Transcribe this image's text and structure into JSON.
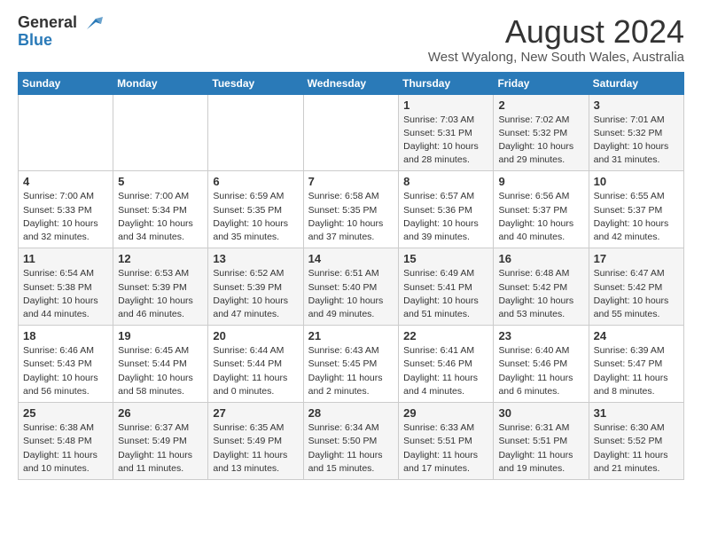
{
  "header": {
    "logo_line1": "General",
    "logo_line2": "Blue",
    "title": "August 2024",
    "subtitle": "West Wyalong, New South Wales, Australia"
  },
  "weekdays": [
    "Sunday",
    "Monday",
    "Tuesday",
    "Wednesday",
    "Thursday",
    "Friday",
    "Saturday"
  ],
  "weeks": [
    [
      {
        "day": "",
        "info": ""
      },
      {
        "day": "",
        "info": ""
      },
      {
        "day": "",
        "info": ""
      },
      {
        "day": "",
        "info": ""
      },
      {
        "day": "1",
        "info": "Sunrise: 7:03 AM\nSunset: 5:31 PM\nDaylight: 10 hours\nand 28 minutes."
      },
      {
        "day": "2",
        "info": "Sunrise: 7:02 AM\nSunset: 5:32 PM\nDaylight: 10 hours\nand 29 minutes."
      },
      {
        "day": "3",
        "info": "Sunrise: 7:01 AM\nSunset: 5:32 PM\nDaylight: 10 hours\nand 31 minutes."
      }
    ],
    [
      {
        "day": "4",
        "info": "Sunrise: 7:00 AM\nSunset: 5:33 PM\nDaylight: 10 hours\nand 32 minutes."
      },
      {
        "day": "5",
        "info": "Sunrise: 7:00 AM\nSunset: 5:34 PM\nDaylight: 10 hours\nand 34 minutes."
      },
      {
        "day": "6",
        "info": "Sunrise: 6:59 AM\nSunset: 5:35 PM\nDaylight: 10 hours\nand 35 minutes."
      },
      {
        "day": "7",
        "info": "Sunrise: 6:58 AM\nSunset: 5:35 PM\nDaylight: 10 hours\nand 37 minutes."
      },
      {
        "day": "8",
        "info": "Sunrise: 6:57 AM\nSunset: 5:36 PM\nDaylight: 10 hours\nand 39 minutes."
      },
      {
        "day": "9",
        "info": "Sunrise: 6:56 AM\nSunset: 5:37 PM\nDaylight: 10 hours\nand 40 minutes."
      },
      {
        "day": "10",
        "info": "Sunrise: 6:55 AM\nSunset: 5:37 PM\nDaylight: 10 hours\nand 42 minutes."
      }
    ],
    [
      {
        "day": "11",
        "info": "Sunrise: 6:54 AM\nSunset: 5:38 PM\nDaylight: 10 hours\nand 44 minutes."
      },
      {
        "day": "12",
        "info": "Sunrise: 6:53 AM\nSunset: 5:39 PM\nDaylight: 10 hours\nand 46 minutes."
      },
      {
        "day": "13",
        "info": "Sunrise: 6:52 AM\nSunset: 5:39 PM\nDaylight: 10 hours\nand 47 minutes."
      },
      {
        "day": "14",
        "info": "Sunrise: 6:51 AM\nSunset: 5:40 PM\nDaylight: 10 hours\nand 49 minutes."
      },
      {
        "day": "15",
        "info": "Sunrise: 6:49 AM\nSunset: 5:41 PM\nDaylight: 10 hours\nand 51 minutes."
      },
      {
        "day": "16",
        "info": "Sunrise: 6:48 AM\nSunset: 5:42 PM\nDaylight: 10 hours\nand 53 minutes."
      },
      {
        "day": "17",
        "info": "Sunrise: 6:47 AM\nSunset: 5:42 PM\nDaylight: 10 hours\nand 55 minutes."
      }
    ],
    [
      {
        "day": "18",
        "info": "Sunrise: 6:46 AM\nSunset: 5:43 PM\nDaylight: 10 hours\nand 56 minutes."
      },
      {
        "day": "19",
        "info": "Sunrise: 6:45 AM\nSunset: 5:44 PM\nDaylight: 10 hours\nand 58 minutes."
      },
      {
        "day": "20",
        "info": "Sunrise: 6:44 AM\nSunset: 5:44 PM\nDaylight: 11 hours\nand 0 minutes."
      },
      {
        "day": "21",
        "info": "Sunrise: 6:43 AM\nSunset: 5:45 PM\nDaylight: 11 hours\nand 2 minutes."
      },
      {
        "day": "22",
        "info": "Sunrise: 6:41 AM\nSunset: 5:46 PM\nDaylight: 11 hours\nand 4 minutes."
      },
      {
        "day": "23",
        "info": "Sunrise: 6:40 AM\nSunset: 5:46 PM\nDaylight: 11 hours\nand 6 minutes."
      },
      {
        "day": "24",
        "info": "Sunrise: 6:39 AM\nSunset: 5:47 PM\nDaylight: 11 hours\nand 8 minutes."
      }
    ],
    [
      {
        "day": "25",
        "info": "Sunrise: 6:38 AM\nSunset: 5:48 PM\nDaylight: 11 hours\nand 10 minutes."
      },
      {
        "day": "26",
        "info": "Sunrise: 6:37 AM\nSunset: 5:49 PM\nDaylight: 11 hours\nand 11 minutes."
      },
      {
        "day": "27",
        "info": "Sunrise: 6:35 AM\nSunset: 5:49 PM\nDaylight: 11 hours\nand 13 minutes."
      },
      {
        "day": "28",
        "info": "Sunrise: 6:34 AM\nSunset: 5:50 PM\nDaylight: 11 hours\nand 15 minutes."
      },
      {
        "day": "29",
        "info": "Sunrise: 6:33 AM\nSunset: 5:51 PM\nDaylight: 11 hours\nand 17 minutes."
      },
      {
        "day": "30",
        "info": "Sunrise: 6:31 AM\nSunset: 5:51 PM\nDaylight: 11 hours\nand 19 minutes."
      },
      {
        "day": "31",
        "info": "Sunrise: 6:30 AM\nSunset: 5:52 PM\nDaylight: 11 hours\nand 21 minutes."
      }
    ]
  ]
}
